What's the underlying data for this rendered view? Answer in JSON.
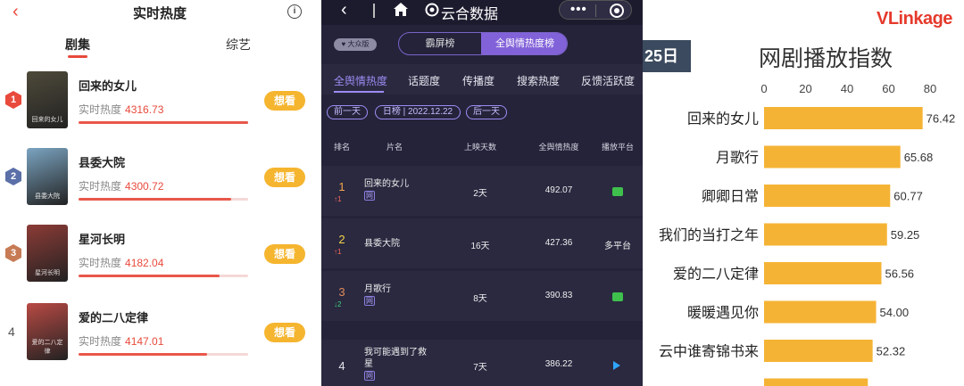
{
  "panel1": {
    "title": "实时热度",
    "back_glyph": "‹",
    "info_glyph": "i",
    "tabs": [
      {
        "label": "剧集"
      },
      {
        "label": "综艺"
      }
    ],
    "heat_label": "实时热度",
    "want_label": "想看",
    "items": [
      {
        "rank": "1",
        "name": "回来的女儿",
        "heat": "4316.73",
        "fill": 1.0,
        "badge_color": "#e84a3c",
        "poster_bg": "#4e4a3a",
        "poster_text": "回来的女儿"
      },
      {
        "rank": "2",
        "name": "县委大院",
        "heat": "4300.72",
        "fill": 0.9,
        "badge_color": "#5b6fa8",
        "poster_bg": "#7ba4c1",
        "poster_text": "县委大院"
      },
      {
        "rank": "3",
        "name": "星河长明",
        "heat": "4182.04",
        "fill": 0.83,
        "badge_color": "#c77b54",
        "poster_bg": "#8c3b36",
        "poster_text": "星河长明"
      },
      {
        "rank": "4",
        "name": "爱的二八定律",
        "heat": "4147.01",
        "fill": 0.76,
        "badge_color": "",
        "poster_bg": "#b94a44",
        "poster_text": "爱的二八定律"
      }
    ]
  },
  "panel2": {
    "back_glyph": "‹",
    "brand": "云合数据",
    "brand_icon": "cloud-logo-icon",
    "capsule_dots": "•••",
    "version_label": "大众版",
    "seg_tabs": [
      {
        "label": "霸屏榜"
      },
      {
        "label": "全舆情热度榜"
      }
    ],
    "sub_tabs": [
      {
        "label": "全舆情热度"
      },
      {
        "label": "话题度"
      },
      {
        "label": "传播度"
      },
      {
        "label": "搜索热度"
      },
      {
        "label": "反馈活跃度"
      }
    ],
    "prev_day": "前一天",
    "date_label": "日榜 | 2022.12.22",
    "next_day": "后一天",
    "headers": {
      "rank": "排名",
      "name": "片名",
      "days": "上映天数",
      "heat": "全舆情热度",
      "platform": "播放平台"
    },
    "rows": [
      {
        "rank": "1",
        "rank_color": "#f2a54a",
        "change": "↑1",
        "change_color": "#ff6a5a",
        "title": "回来的女儿",
        "tag": "网",
        "days": "2天",
        "heat": "492.07",
        "platform": "iqiyi-icon",
        "platform_text": ""
      },
      {
        "rank": "2",
        "rank_color": "#f2d24a",
        "change": "↑1",
        "change_color": "#ff6a5a",
        "title": "县委大院",
        "tag": "",
        "days": "16天",
        "heat": "427.36",
        "platform": "",
        "platform_text": "多平台"
      },
      {
        "rank": "3",
        "rank_color": "#e08a5a",
        "change": "↓2",
        "change_color": "#3fd17a",
        "title": "月歌行",
        "tag": "网",
        "days": "8天",
        "heat": "390.83",
        "platform": "iqiyi-icon",
        "platform_text": ""
      },
      {
        "rank": "4",
        "rank_color": "#e5e5ee",
        "change": "",
        "change_color": "",
        "title": "我可能遇到了救星",
        "tag": "网",
        "days": "7天",
        "heat": "386.22",
        "platform": "youku-icon",
        "platform_text": ""
      }
    ]
  },
  "panel3": {
    "date_fragment": "25日",
    "logo_v": "V",
    "logo_rest": "Linkage",
    "chart_data": {
      "type": "bar",
      "orientation": "horizontal",
      "title": "网剧播放指数",
      "categories": [
        "回来的女儿",
        "月歌行",
        "卿卿日常",
        "我们的当打之年",
        "爱的二八定律",
        "暖暖遇见你",
        "云中谁寄锦书来"
      ],
      "values": [
        76.42,
        65.68,
        60.77,
        59.25,
        56.56,
        54.0,
        52.32
      ],
      "value_labels": [
        "76.42",
        "65.68",
        "60.77",
        "59.25",
        "56.56",
        "54.00",
        "52.32"
      ],
      "xticks": [
        "0",
        "20",
        "40",
        "60",
        "80"
      ],
      "xlim": [
        0,
        80
      ],
      "bar_color": "#f5b335"
    }
  }
}
